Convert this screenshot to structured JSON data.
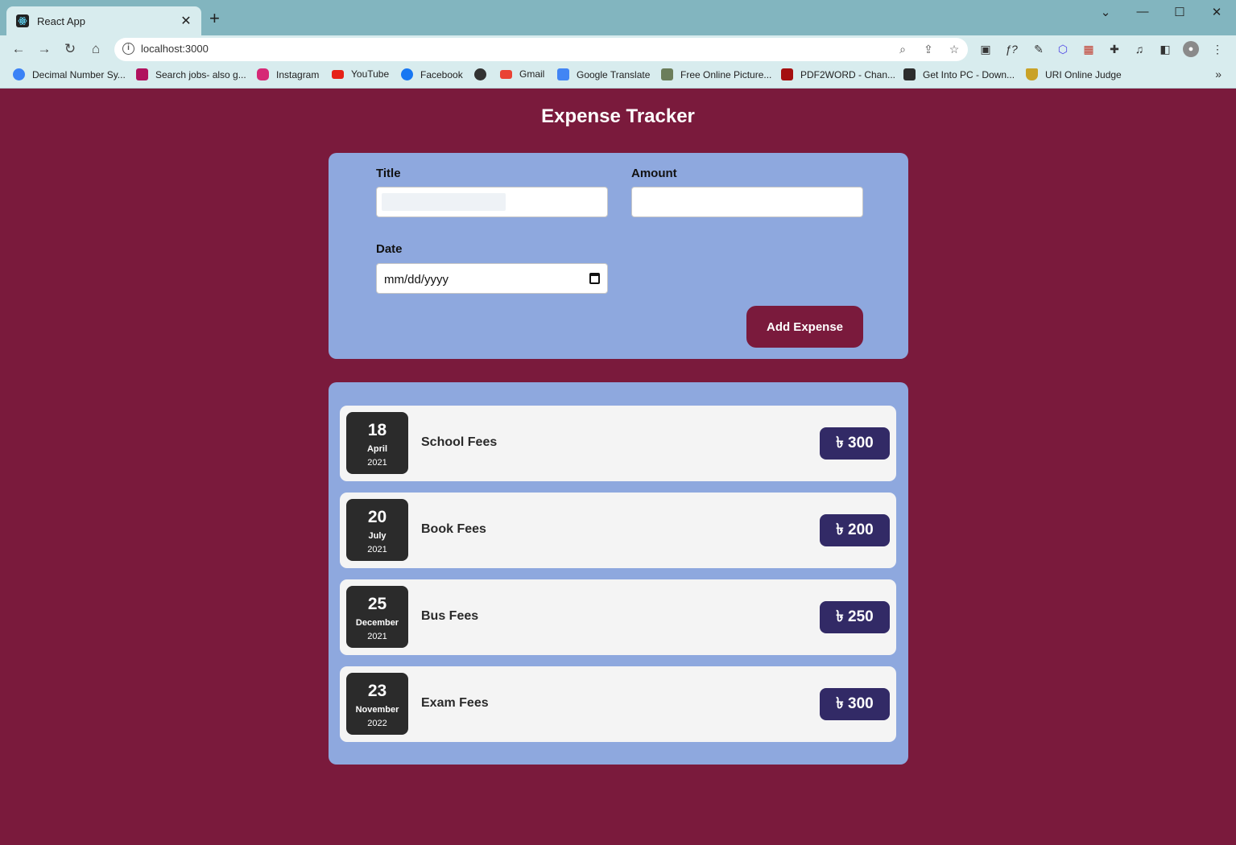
{
  "browser": {
    "tab_title": "React App",
    "url": "localhost:3000",
    "bookmarks": [
      {
        "label": "Decimal Number Sy...",
        "color": "#3b82f6"
      },
      {
        "label": "Search jobs- also g...",
        "color": "#b0115e"
      },
      {
        "label": "Instagram",
        "color": "#d62976"
      },
      {
        "label": "YouTube",
        "color": "#e62117"
      },
      {
        "label": "Facebook",
        "color": "#1877f2"
      },
      {
        "label": "",
        "color": "#333333"
      },
      {
        "label": "Gmail",
        "color": "#ea4335"
      },
      {
        "label": "Google Translate",
        "color": "#4285f4"
      },
      {
        "label": "Free Online Picture...",
        "color": "#6b7d5a"
      },
      {
        "label": "PDF2WORD - Chan...",
        "color": "#a40f0f"
      },
      {
        "label": "Get Into PC - Down...",
        "color": "#2d2d2d"
      },
      {
        "label": "URI Online Judge",
        "color": "#c9a227"
      }
    ]
  },
  "app": {
    "title": "Expense Tracker",
    "form": {
      "title_label": "Title",
      "amount_label": "Amount",
      "date_label": "Date",
      "date_placeholder": "mm/dd/yyyy",
      "title_value": "",
      "amount_value": "",
      "submit_label": "Add Expense"
    },
    "expenses": [
      {
        "day": "18",
        "month": "April",
        "year": "2021",
        "title": "School Fees",
        "amount": "৳ 300"
      },
      {
        "day": "20",
        "month": "July",
        "year": "2021",
        "title": "Book Fees",
        "amount": "৳ 200"
      },
      {
        "day": "25",
        "month": "December",
        "year": "2021",
        "title": "Bus Fees",
        "amount": "৳ 250"
      },
      {
        "day": "23",
        "month": "November",
        "year": "2022",
        "title": "Exam Fees",
        "amount": "৳ 300"
      }
    ]
  },
  "colors": {
    "page_bg": "#7a1a3c",
    "card_bg": "#8ea8de",
    "row_bg": "#f4f4f4",
    "date_badge": "#2b2b2b",
    "amount_pill": "#322a66"
  }
}
